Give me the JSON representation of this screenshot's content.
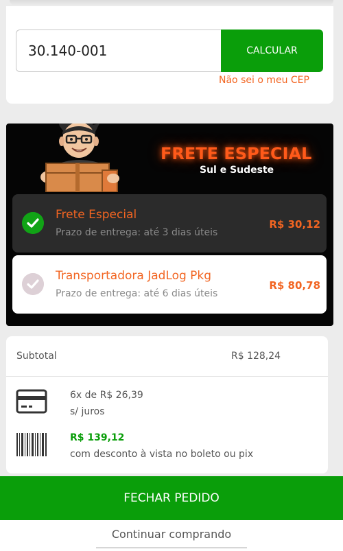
{
  "cep": {
    "value": "30.140-001",
    "button_label": "CALCULAR",
    "help_link": "Não sei o meu CEP"
  },
  "shipping": {
    "banner_title": "FRETE ESPECIAL",
    "banner_subtitle": "Sul e Sudeste",
    "options": [
      {
        "name": "Frete Especial",
        "term": "Prazo de entrega: até 3 dias úteis",
        "price": "R$ 30,12",
        "selected": true
      },
      {
        "name": "Transportadora JadLog Pkg",
        "term": "Prazo de entrega: até 6 dias úteis",
        "price": "R$ 80,78",
        "selected": false
      }
    ]
  },
  "summary": {
    "subtotal_label": "Subtotal",
    "subtotal_value": "R$ 128,24",
    "installments_line1": "6x de R$ 26,39",
    "installments_line2": "s/ juros",
    "boleto_price": "R$ 139,12",
    "boleto_desc": "com desconto à vista no boleto ou pix"
  },
  "actions": {
    "checkout_label": "FECHAR PEDIDO",
    "continue_label": "Continuar comprando"
  },
  "icons": {
    "credit_card": "credit-card-icon",
    "barcode": "barcode-icon",
    "check": "check-icon"
  },
  "colors": {
    "brand_green": "#0a9e0a",
    "accent_orange": "#f26522",
    "dark_card": "#050505"
  }
}
